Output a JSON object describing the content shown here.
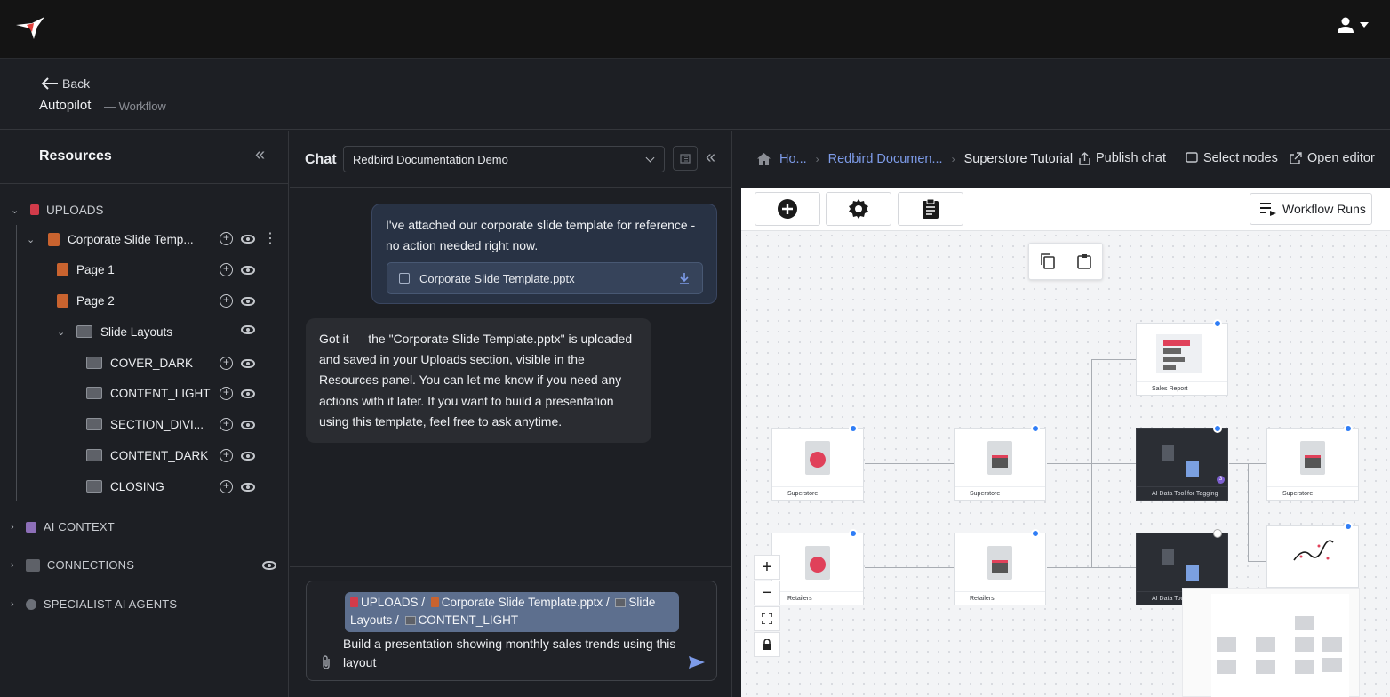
{
  "topbar": {
    "logo": "hummingbird-logo",
    "user_icon": "user-icon"
  },
  "header": {
    "back_label": "Back",
    "title": "Autopilot",
    "subtitle": "— Workflow"
  },
  "resources": {
    "title": "Resources",
    "uploads_label": "UPLOADS",
    "file_label": "Corporate Slide Temp...",
    "page1": "Page 1",
    "page2": "Page 2",
    "slide_layouts": "Slide Layouts",
    "layouts": [
      "COVER_DARK",
      "CONTENT_LIGHT",
      "SECTION_DIVI...",
      "CONTENT_DARK",
      "CLOSING"
    ],
    "ai_context": "AI CONTEXT",
    "connections": "CONNECTIONS",
    "agents": "SPECIALIST AI AGENTS"
  },
  "chat": {
    "title": "Chat",
    "selected": "Redbird Documentation Demo",
    "user_message": "I've attached our corporate slide template for reference - no action needed right now.",
    "attachment": "Corporate Slide Template.pptx",
    "bot_message": "Got it — the \"Corporate Slide Template.pptx\" is uploaded and saved in your Uploads section, visible in the Resources panel. You can let me know if you need any actions with it later. If you want to build a presentation using this template, feel free to ask anytime.",
    "context_chip": {
      "p1": "UPLOADS /",
      "p2": "Corporate Slide Template.pptx /",
      "p3": "Slide Layouts /",
      "p4": "CONTENT_LIGHT"
    },
    "compose_text": "Build a presentation showing monthly sales trends using this layout"
  },
  "breadcrumbs": {
    "home": "Ho...",
    "project": "Redbird Documen...",
    "current": "Superstore Tutorial"
  },
  "actions": {
    "publish": "Publish chat",
    "select": "Select nodes",
    "editor": "Open editor"
  },
  "canvas": {
    "workflow_runs": "Workflow Runs",
    "nodes": {
      "n1": "Superstore",
      "n2": "Superstore",
      "n3": "Sales Report",
      "n4": "AI Data Tool for Tagging",
      "n5": "Superstore",
      "n6": "Retailers",
      "n7": "Retailers",
      "n8": "AI Data Too",
      "n4_badge": "3"
    },
    "colors": {
      "accent": "#2f7df6",
      "ppt": "#c9632f",
      "link": "#7d9be8"
    }
  }
}
